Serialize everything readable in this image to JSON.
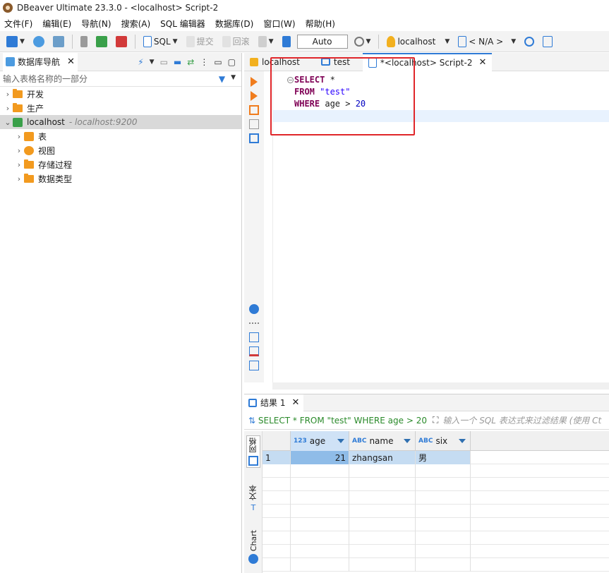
{
  "window": {
    "title": "DBeaver Ultimate 23.3.0 - <localhost> Script-2"
  },
  "menu": [
    {
      "label": "文件(F)"
    },
    {
      "label": "编辑(E)"
    },
    {
      "label": "导航(N)"
    },
    {
      "label": "搜索(A)"
    },
    {
      "label": "SQL 编辑器"
    },
    {
      "label": "数据库(D)"
    },
    {
      "label": "窗口(W)"
    },
    {
      "label": "帮助(H)"
    }
  ],
  "toolbar": {
    "sql_label": "SQL",
    "commit_label": "提交",
    "rollback_label": "回滚",
    "tx_mode": "Auto",
    "connection": "localhost",
    "schema": "< N/A >"
  },
  "navigator": {
    "tab_label": "数据库导航",
    "filter_placeholder": "输入表格名称的一部分",
    "tree": [
      {
        "label": "开发"
      },
      {
        "label": "生产"
      },
      {
        "label": "localhost",
        "sub": "- localhost:9200"
      },
      {
        "label": "表"
      },
      {
        "label": "视图"
      },
      {
        "label": "存储过程"
      },
      {
        "label": "数据类型"
      }
    ]
  },
  "editor": {
    "tabs": [
      {
        "label": "localhost"
      },
      {
        "label": "test"
      },
      {
        "label": "*<localhost> Script-2"
      }
    ],
    "code": {
      "kw_select": "SELECT",
      "star": " *",
      "kw_from": "FROM",
      "table": " \"test\"",
      "kw_where": "WHERE",
      "cond": " age > ",
      "value": "20"
    }
  },
  "results": {
    "tab_label": "结果 1",
    "query": "SELECT * FROM \"test\" WHERE age > 20",
    "filter_placeholder": "输入一个 SQL 表达式来过滤结果 (使用 Ct",
    "side_tabs": [
      "网格",
      "文本",
      "Chart"
    ],
    "columns": [
      {
        "type": "123",
        "name": "age"
      },
      {
        "type": "ABC",
        "name": "name"
      },
      {
        "type": "ABC",
        "name": "six"
      }
    ],
    "rows": [
      {
        "num": "1",
        "age": "21",
        "name": "zhangsan",
        "six": "男"
      }
    ]
  },
  "colors": {
    "accent": "#2f7bd6",
    "highlight": "#e0262a",
    "keyword": "#7f0055"
  }
}
